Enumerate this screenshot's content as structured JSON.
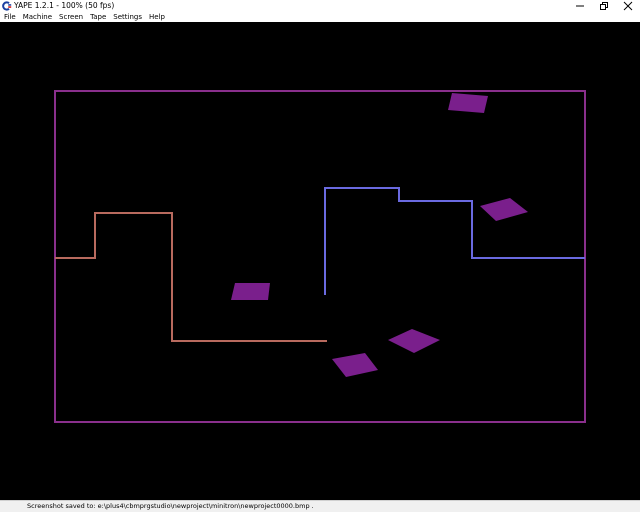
{
  "window": {
    "title": "YAPE 1.2.1 - 100% (50 fps)",
    "icon": "commodore-logo-icon",
    "controls": [
      "minimize-icon",
      "restore-icon",
      "close-icon"
    ]
  },
  "menu": {
    "items": [
      {
        "label": "File"
      },
      {
        "label": "Machine"
      },
      {
        "label": "Screen"
      },
      {
        "label": "Tape"
      },
      {
        "label": "Settings"
      },
      {
        "label": "Help"
      }
    ]
  },
  "game": {
    "background_color": "#000000",
    "arena_color": "#8a2f8c",
    "player_trail_color": "#b86a5e",
    "enemy_trail_color": "#6a6ae0",
    "obstacle_color": "#7a1f8c"
  },
  "status": {
    "text": "Screenshot saved to: e:\\plus4\\cbmprgstudio\\newproject\\minitron\\newproject0000.bmp ."
  }
}
